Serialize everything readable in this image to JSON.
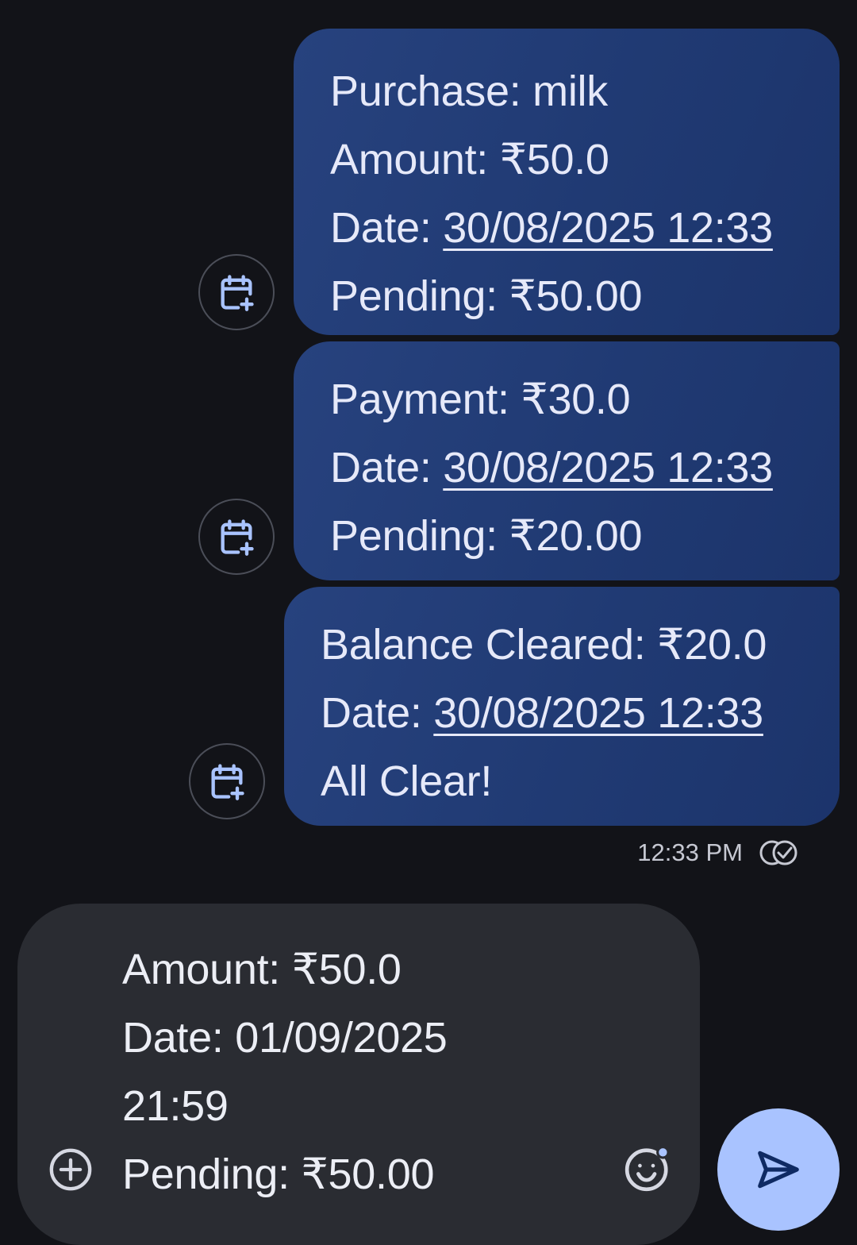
{
  "messages": [
    {
      "lines": [
        {
          "text": "Purchase: milk"
        },
        {
          "text": "Amount: ₹50.0"
        },
        {
          "label": "Date: ",
          "value": "30/08/2025 12:33"
        },
        {
          "text": "Pending: ₹50.00"
        }
      ],
      "action_icon": "calendar-add-icon"
    },
    {
      "lines": [
        {
          "text": "Payment: ₹30.0"
        },
        {
          "label": "Date: ",
          "value": "30/08/2025 12:33"
        },
        {
          "text": "Pending: ₹20.00"
        }
      ],
      "action_icon": "calendar-add-icon"
    },
    {
      "lines": [
        {
          "text": "Balance Cleared: ₹20.0"
        },
        {
          "label": "Date: ",
          "value": "30/08/2025 12:33"
        },
        {
          "text": "All Clear!"
        }
      ],
      "action_icon": "calendar-add-icon"
    }
  ],
  "status": {
    "time": "12:33 PM",
    "icon": "read-receipt-icon"
  },
  "compose": {
    "lines": [
      "Amount: ₹50.0",
      "Date: 01/09/2025",
      "21:59",
      "Pending: ₹50.00"
    ],
    "left_icon": "add-circle-icon",
    "right_icon": "emoji-icon"
  },
  "send": {
    "icon": "send-icon"
  },
  "colors": {
    "background": "#121318",
    "sent_bubble": "#203a73",
    "compose_bg": "#2a2c32",
    "send_button": "#a9c3ff",
    "icon_accent": "#a9c3ff"
  }
}
